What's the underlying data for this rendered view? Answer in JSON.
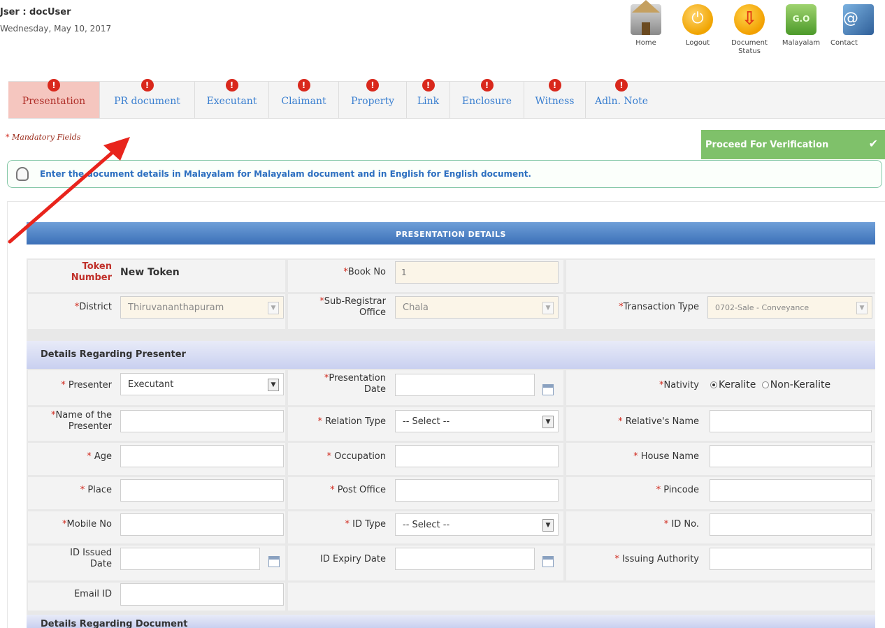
{
  "header": {
    "user": "Jser : docUser",
    "date": "Wednesday, May 10, 2017"
  },
  "top_icons": [
    {
      "label": "Home",
      "icon": "home-icon"
    },
    {
      "label": "Logout",
      "icon": "power-icon"
    },
    {
      "label": "Document Status",
      "icon": "download-icon"
    },
    {
      "label": "Malayalam",
      "icon": "malayalam-icon"
    },
    {
      "label": "Contact",
      "icon": "contact-icon"
    }
  ],
  "tabs": [
    {
      "label": "Presentation",
      "badge": "!"
    },
    {
      "label": "PR document",
      "badge": "!"
    },
    {
      "label": "Executant",
      "badge": "!"
    },
    {
      "label": "Claimant",
      "badge": "!"
    },
    {
      "label": "Property",
      "badge": "!"
    },
    {
      "label": "Link",
      "badge": "!"
    },
    {
      "label": "Enclosure",
      "badge": "!"
    },
    {
      "label": "Witness",
      "badge": "!"
    },
    {
      "label": "Adln. Note",
      "badge": "!"
    }
  ],
  "mandatory_note": "Mandatory Fields",
  "proceed_button": "Proceed For Verification",
  "info_text": "Enter the document details in Malayalam for Malayalam document and in English for English document.",
  "section_title": "PRESENTATION DETAILS",
  "top_fields": {
    "token_label_1": "Token",
    "token_label_2": "Number",
    "token_value": "New Token",
    "book_no_label": "Book No",
    "book_no_value": "1",
    "district_label": "District",
    "district_value": "Thiruvananthapuram",
    "sro_label_1": "Sub-Registrar",
    "sro_label_2": "Office",
    "sro_value": "Chala",
    "transaction_label": "Transaction Type",
    "transaction_value": "0702-Sale - Conveyance"
  },
  "presenter_section": {
    "title": "Details Regarding Presenter",
    "presenter_label": "Presenter",
    "presenter_value": "Executant",
    "presentation_date_label_1": "Presentation",
    "presentation_date_label_2": "Date",
    "nativity_label": "Nativity",
    "nativity_options": [
      "Keralite",
      "Non-Keralite"
    ],
    "name_label_1": "Name of the",
    "name_label_2": "Presenter",
    "relation_type_label": "Relation Type",
    "relation_type_value": "-- Select --",
    "relatives_name_label": "Relative's Name",
    "age_label": "Age",
    "occupation_label": "Occupation",
    "house_name_label": "House Name",
    "place_label": "Place",
    "post_office_label": "Post Office",
    "pincode_label": "Pincode",
    "mobile_label": "Mobile No",
    "id_type_label": "ID Type",
    "id_type_value": "-- Select --",
    "id_no_label": "ID No.",
    "id_issued_label_1": "ID Issued",
    "id_issued_label_2": "Date",
    "id_expiry_label": "ID Expiry Date",
    "issuing_authority_label": "Issuing Authority",
    "email_label": "Email ID"
  },
  "document_section": {
    "title": "Details Regarding Document"
  },
  "colors": {
    "accent_blue": "#3b70b8",
    "tab_active_bg": "#f5c6bf",
    "required_red": "#d0281c",
    "proceed_green": "#7fc16a",
    "annotation_arrow": "#e8241c"
  }
}
